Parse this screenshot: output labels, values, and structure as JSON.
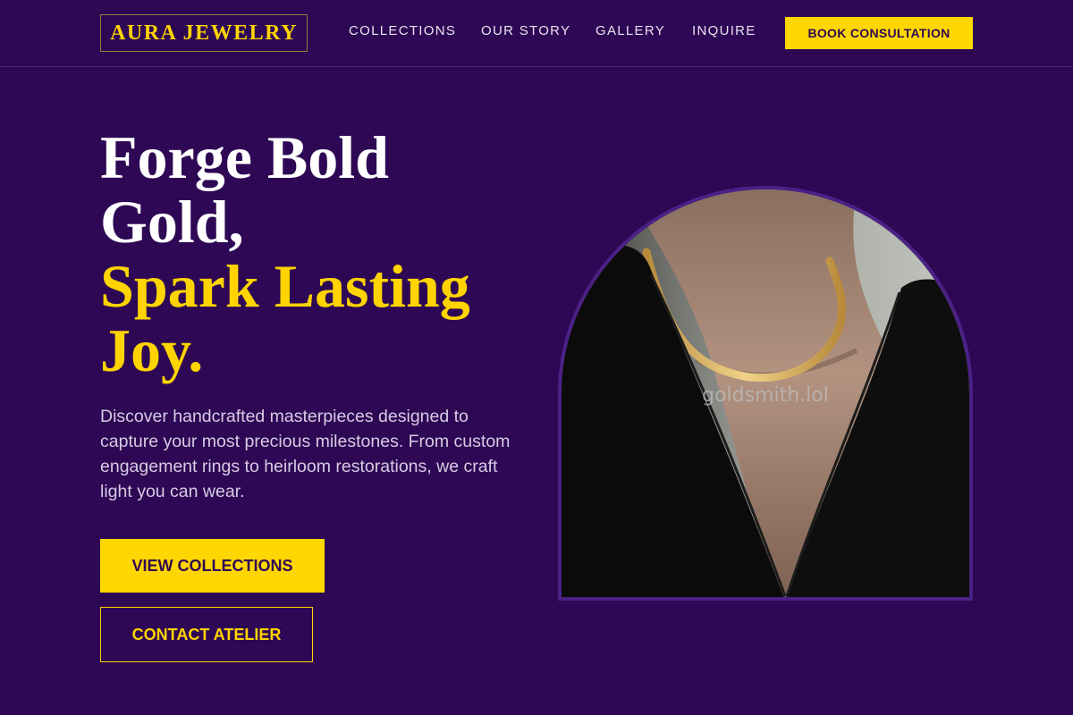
{
  "header": {
    "logo": "AURA JEWELRY",
    "nav": [
      {
        "label": "COLLECTIONS"
      },
      {
        "label": "OUR STORY"
      },
      {
        "label": "GALLERY"
      },
      {
        "label": "INQUIRE"
      }
    ],
    "cta": "BOOK CONSULTATION"
  },
  "hero": {
    "headline_line1": "Forge Bold Gold,",
    "headline_line2": "Spark Lasting Joy.",
    "description": "Discover handcrafted masterpieces designed to capture your most precious milestones. From custom engagement rings to heirloom restorations, we craft light you can wear.",
    "primary_button": "VIEW COLLECTIONS",
    "secondary_button": "CONTACT ATELIER",
    "image_watermark": "goldsmith.lol"
  },
  "colors": {
    "background": "#2e0854",
    "accent": "#ffd700",
    "text": "#ffffff"
  }
}
